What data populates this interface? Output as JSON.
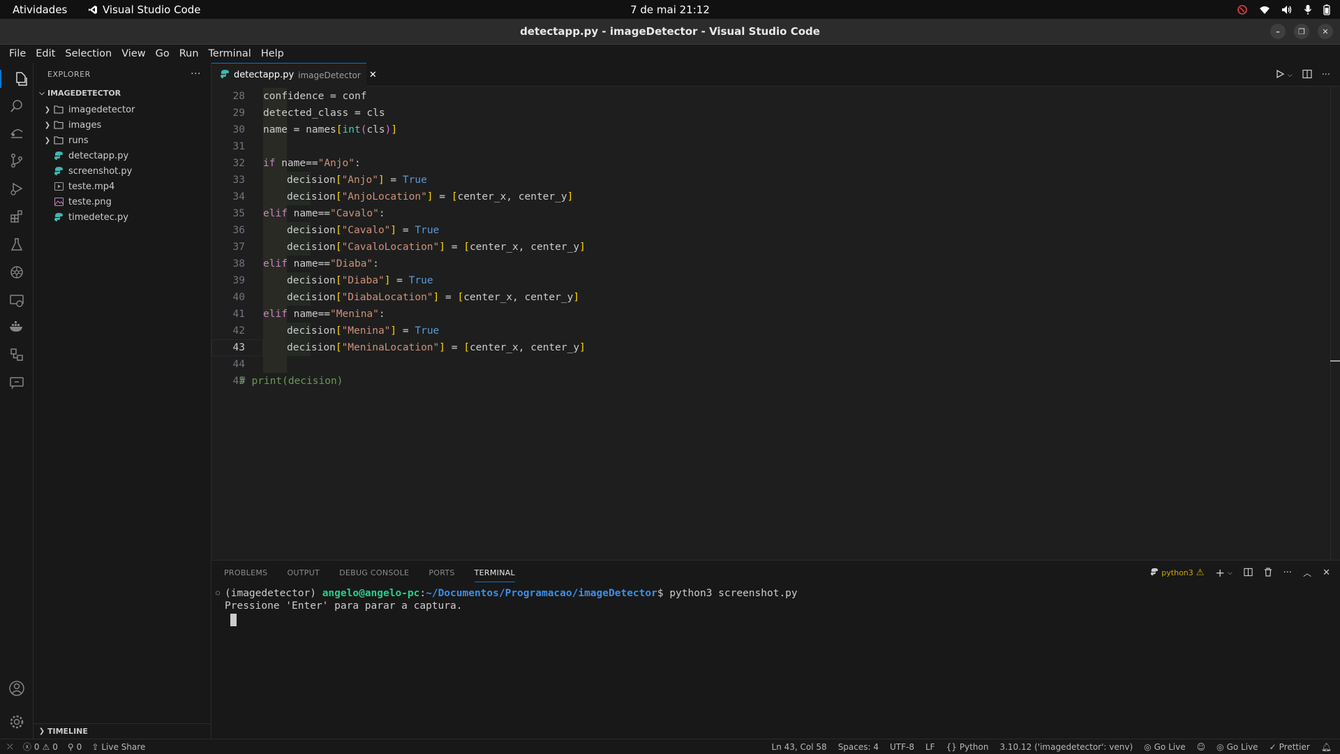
{
  "topbar": {
    "activities": "Atividades",
    "app_name": "Visual Studio Code",
    "clock": "7 de mai  21:12",
    "tray_icons": [
      "recording-icon",
      "wifi-icon",
      "volume-icon",
      "microphone-icon",
      "battery-icon"
    ]
  },
  "window": {
    "title": "detectapp.py - imageDetector - Visual Studio Code"
  },
  "menubar": {
    "items": [
      "File",
      "Edit",
      "Selection",
      "View",
      "Go",
      "Run",
      "Terminal",
      "Help"
    ]
  },
  "activitybar": {
    "icons": [
      "explorer-icon",
      "search-icon",
      "remote-explorer-icon",
      "source-control-icon",
      "run-debug-icon",
      "extensions-icon",
      "testing-icon",
      "kubernetes-icon",
      "remote-icon",
      "docker-icon",
      "project-manager-icon",
      "live-share-icon"
    ],
    "bottom_icons": [
      "account-icon",
      "settings-icon"
    ]
  },
  "sidebar": {
    "title": "EXPLORER",
    "project": "IMAGEDETECTOR",
    "tree": [
      {
        "name": "imagedetector",
        "type": "folder"
      },
      {
        "name": "images",
        "type": "folder"
      },
      {
        "name": "runs",
        "type": "folder"
      },
      {
        "name": "detectapp.py",
        "type": "python"
      },
      {
        "name": "screenshot.py",
        "type": "python"
      },
      {
        "name": "teste.mp4",
        "type": "video"
      },
      {
        "name": "teste.png",
        "type": "image"
      },
      {
        "name": "timedetec.py",
        "type": "python"
      }
    ],
    "timeline": "TIMELINE"
  },
  "tab": {
    "filename": "detectapp.py",
    "description": "imageDetector"
  },
  "editor": {
    "current_line": 43,
    "lines": [
      {
        "n": "28",
        "indent": 1
      },
      {
        "n": "29",
        "indent": 1
      },
      {
        "n": "30",
        "indent": 1
      },
      {
        "n": "31",
        "indent": 1
      },
      {
        "n": "32",
        "indent": 1
      },
      {
        "n": "33",
        "indent": 2
      },
      {
        "n": "34",
        "indent": 2
      },
      {
        "n": "35",
        "indent": 1
      },
      {
        "n": "36",
        "indent": 2
      },
      {
        "n": "37",
        "indent": 2
      },
      {
        "n": "38",
        "indent": 1
      },
      {
        "n": "39",
        "indent": 2
      },
      {
        "n": "40",
        "indent": 2
      },
      {
        "n": "41",
        "indent": 1
      },
      {
        "n": "42",
        "indent": 2
      },
      {
        "n": "43",
        "indent": 2
      },
      {
        "n": "44",
        "indent": 1
      },
      {
        "n": "45",
        "indent": 0
      }
    ],
    "code": {
      "l28_a": "confidence",
      "l28_b": " = ",
      "l28_c": "conf",
      "l29_a": "detected_class",
      "l29_b": " = ",
      "l29_c": "cls",
      "l30_a": "name",
      "l30_b": " = ",
      "l30_c": "names",
      "l30_d": "[",
      "l30_e": "int",
      "l30_f": "(",
      "l30_g": "cls",
      "l30_h": ")",
      "l30_i": "]",
      "l32_kw": "if",
      "l32_a": " name",
      "l32_b": "==",
      "l32_c": "\"Anjo\"",
      "l32_d": ":",
      "l33_a": "decision",
      "l33_b": "[",
      "l33_c": "\"Anjo\"",
      "l33_d": "]",
      "l33_e": " = ",
      "l33_f": "True",
      "l34_a": "decision",
      "l34_b": "[",
      "l34_c": "\"AnjoLocation\"",
      "l34_d": "]",
      "l34_e": " = ",
      "l34_f": "[",
      "l34_g": "center_x, center_y",
      "l34_h": "]",
      "l35_kw": "elif",
      "l35_a": " name",
      "l35_b": "==",
      "l35_c": "\"Cavalo\"",
      "l35_d": ":",
      "l36_a": "decision",
      "l36_b": "[",
      "l36_c": "\"Cavalo\"",
      "l36_d": "]",
      "l36_e": " = ",
      "l36_f": "True",
      "l37_a": "decision",
      "l37_b": "[",
      "l37_c": "\"CavaloLocation\"",
      "l37_d": "]",
      "l37_e": " = ",
      "l37_f": "[",
      "l37_g": "center_x, center_y",
      "l37_h": "]",
      "l38_kw": "elif",
      "l38_a": " name",
      "l38_b": "==",
      "l38_c": "\"Diaba\"",
      "l38_d": ":",
      "l39_a": "decision",
      "l39_b": "[",
      "l39_c": "\"Diaba\"",
      "l39_d": "]",
      "l39_e": " = ",
      "l39_f": "True",
      "l40_a": "decision",
      "l40_b": "[",
      "l40_c": "\"DiabaLocation\"",
      "l40_d": "]",
      "l40_e": " = ",
      "l40_f": "[",
      "l40_g": "center_x, center_y",
      "l40_h": "]",
      "l41_kw": "elif",
      "l41_a": " name",
      "l41_b": "==",
      "l41_c": "\"Menina\"",
      "l41_d": ":",
      "l42_a": "decision",
      "l42_b": "[",
      "l42_c": "\"Menina\"",
      "l42_d": "]",
      "l42_e": " = ",
      "l42_f": "True",
      "l43_a": "decision",
      "l43_b": "[",
      "l43_c": "\"MeninaLocation\"",
      "l43_d": "]",
      "l43_e": " = ",
      "l43_f": "[",
      "l43_g": "center_x, center_y",
      "l43_h": "]",
      "l45_a": "# print(decision)"
    }
  },
  "panel": {
    "tabs": [
      "PROBLEMS",
      "OUTPUT",
      "DEBUG CONSOLE",
      "PORTS",
      "TERMINAL"
    ],
    "active_tab": "TERMINAL",
    "shell_name": "python3",
    "terminal": {
      "env": "(imagedetector) ",
      "user_host": "angelo@angelo-pc",
      "colon": ":",
      "path": "~/Documentos/Programacao/imageDetector",
      "prompt_end": "$ ",
      "command": "python3 screenshot.py",
      "output": "Pressione 'Enter' para parar a captura."
    }
  },
  "statusbar": {
    "errors": "0",
    "warnings": "0",
    "ports": "0",
    "live_share": "Live Share",
    "position": "Ln 43, Col 58",
    "spaces": "Spaces: 4",
    "encoding": "UTF-8",
    "eol": "LF",
    "language": "Python",
    "interpreter": "3.10.12 ('imagedetector': venv)",
    "go_live_1": "Go Live",
    "go_live_2": "Go Live",
    "prettier": "Prettier"
  },
  "colors": {
    "accent": "#0078d4",
    "python_icon": "#3fb8af",
    "warning": "#cca700"
  }
}
